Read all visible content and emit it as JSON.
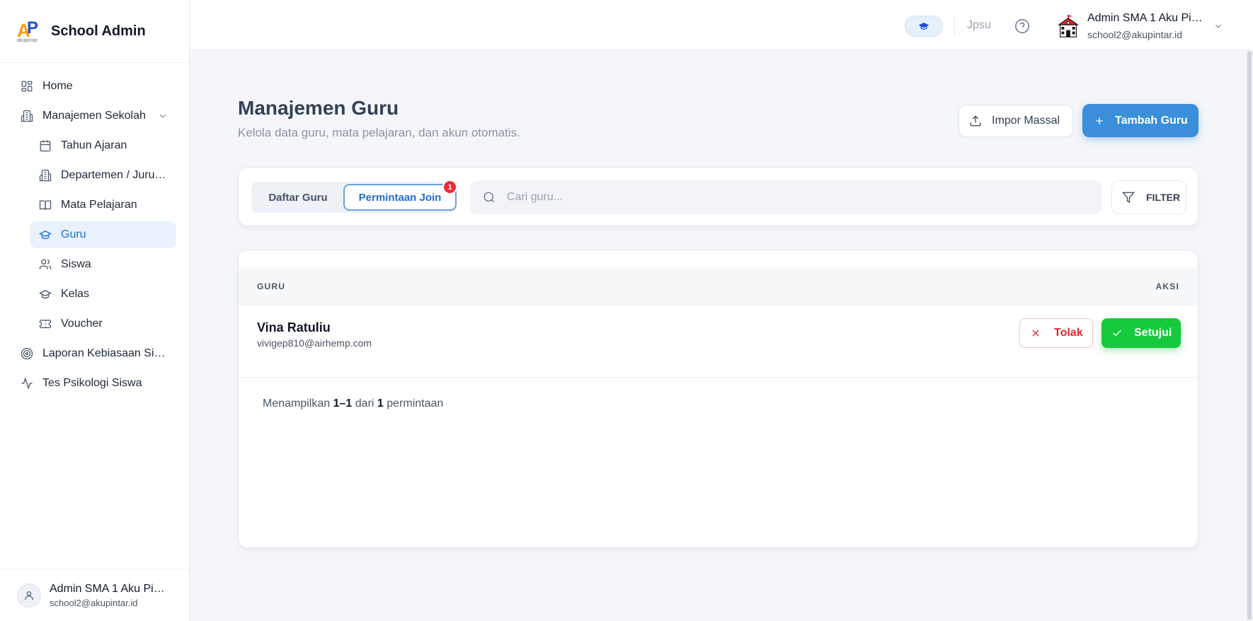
{
  "brand": {
    "name": "School Admin",
    "logo_text": "AP",
    "logo_sub": "akupintar"
  },
  "sidebar": {
    "items": [
      {
        "label": "Home",
        "icon": "dashboard-icon"
      },
      {
        "label": "Manajemen Sekolah",
        "icon": "building-icon",
        "expanded": true
      },
      {
        "label": "Tahun Ajaran",
        "icon": "calendar-icon"
      },
      {
        "label": "Departemen / Jurusan",
        "icon": "building-icon"
      },
      {
        "label": "Mata Pelajaran",
        "icon": "book-icon"
      },
      {
        "label": "Guru",
        "icon": "graduation-cap-icon",
        "active": true
      },
      {
        "label": "Siswa",
        "icon": "users-icon"
      },
      {
        "label": "Kelas",
        "icon": "graduation-cap-icon"
      },
      {
        "label": "Voucher",
        "icon": "ticket-icon"
      },
      {
        "label": "Laporan Kebiasaan Siswa",
        "icon": "target-icon"
      },
      {
        "label": "Tes Psikologi Siswa",
        "icon": "activity-icon"
      }
    ],
    "footer": {
      "name": "Admin SMA 1 Aku Pintar",
      "email": "school2@akupintar.id"
    }
  },
  "topbar": {
    "lang": "Jpsu",
    "user_name": "Admin SMA 1 Aku Pintar",
    "user_email": "school2@akupintar.id"
  },
  "page": {
    "title": "Manajemen Guru",
    "subtitle": "Kelola data guru, mata pelajaran, dan akun otomatis.",
    "import_label": "Impor Massal",
    "add_label": "Tambah Guru"
  },
  "toolbar": {
    "tabs": [
      "Daftar Guru",
      "Permintaan Join"
    ],
    "active_tab": "Permintaan Join",
    "badge_count": "1",
    "search_placeholder": "Cari guru...",
    "filter_label": "FILTER"
  },
  "table": {
    "headers": {
      "guru": "GURU",
      "aksi": "AKSI"
    },
    "rows": [
      {
        "name": "Vina Ratuliu",
        "email": "vivigep810@airhemp.com",
        "reject_label": "Tolak",
        "approve_label": "Setujui"
      }
    ],
    "summary": {
      "prefix": "Menampilkan",
      "range": "1–1",
      "mid": "dari",
      "total": "1",
      "suffix": "permintaan"
    }
  },
  "colors": {
    "accent": "#3b8ed9",
    "active_nav": "#1d6fd1",
    "approve": "#16c93d",
    "reject": "#e02430",
    "badge": "#ef2a35"
  }
}
